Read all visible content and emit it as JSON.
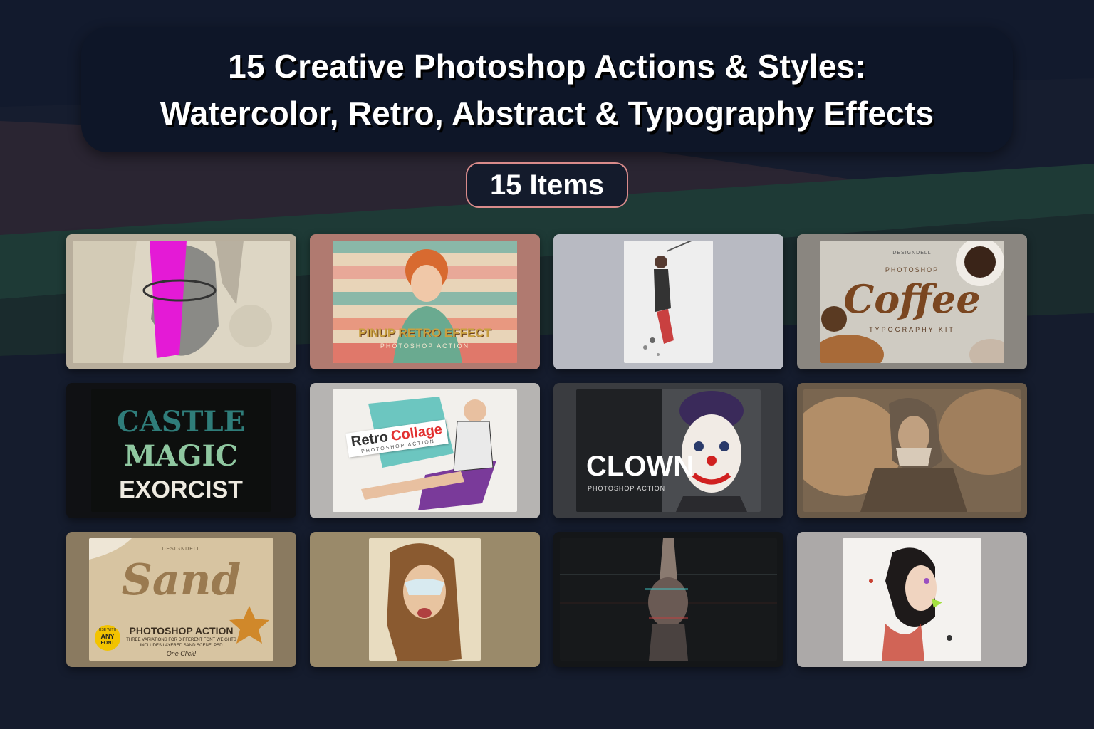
{
  "header": {
    "title_line1": "15 Creative Photoshop Actions & Styles:",
    "title_line2": "Watercolor, Retro, Abstract & Typography Effects"
  },
  "badge": {
    "label": "15 Items"
  },
  "cards": {
    "retro": {
      "title": "PINUP RETRO EFFECT",
      "subtitle": "PHOTOSHOP ACTION"
    },
    "coffee": {
      "brand": "DESIGNDELL",
      "kicker": "PHOTOSHOP",
      "word": "Coffee",
      "footer": "TYPOGRAPHY KIT"
    },
    "horror": {
      "line1": "CASTLE",
      "line2": "MAGIC",
      "line3": "EXORCIST"
    },
    "collage": {
      "word1": "Retro",
      "word2": "Collage",
      "subtitle": "PHOTOSHOP ACTION"
    },
    "clown": {
      "word": "CLOWN",
      "subtitle": "PHOTOSHOP ACTION"
    },
    "sand": {
      "brand": "DESIGNDELL",
      "word": "Sand",
      "title": "PHOTOSHOP ACTION",
      "desc1": "THREE VARIATIONS FOR DIFFERENT FONT WEIGHTS",
      "desc2": "INCLUDES LAYERED SAND SCENE .PSD",
      "badge_use": "USE WITH",
      "badge_any": "ANY",
      "badge_font": "FONT",
      "one_click": "One Click!"
    }
  }
}
